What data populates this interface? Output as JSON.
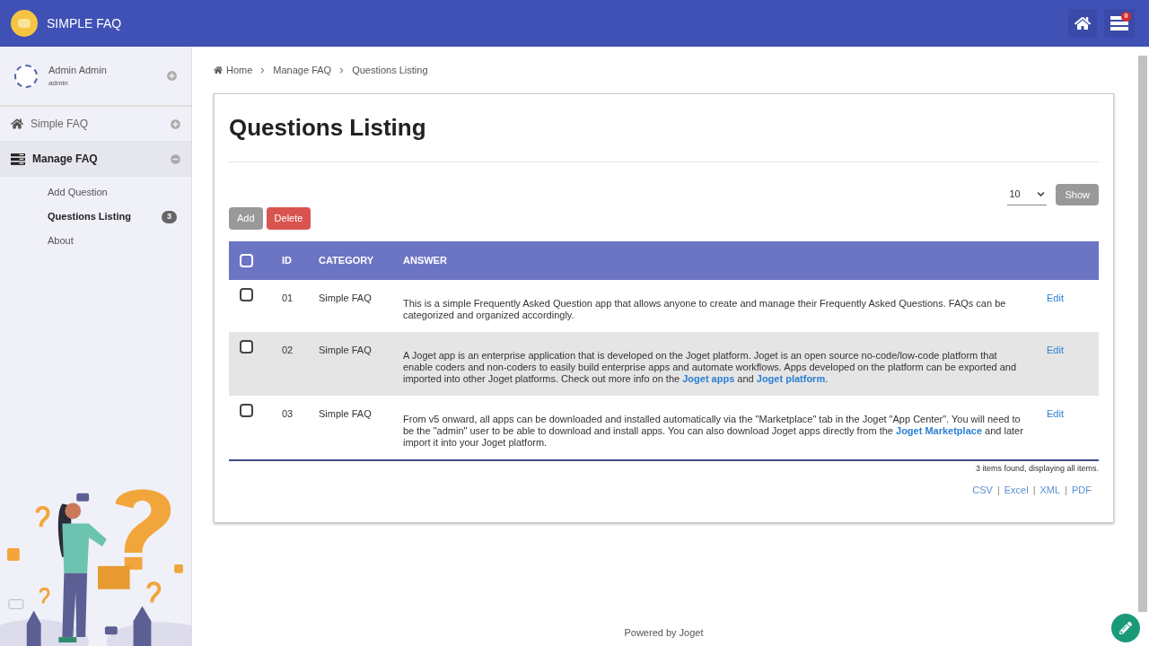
{
  "header": {
    "title": "SIMPLE FAQ",
    "notification_count": "0"
  },
  "sidebar": {
    "user": {
      "name": "Admin Admin",
      "username": "admin"
    },
    "menus": [
      {
        "label": "Simple FAQ",
        "expanded": false,
        "selected": false
      },
      {
        "label": "Manage FAQ",
        "expanded": true,
        "selected": true,
        "children": [
          {
            "label": "Add Question",
            "selected": false
          },
          {
            "label": "Questions Listing",
            "selected": true,
            "badge": "3"
          },
          {
            "label": "About",
            "selected": false
          }
        ]
      }
    ]
  },
  "breadcrumb": [
    "Home",
    "Manage FAQ",
    "Questions Listing"
  ],
  "page_title": "Questions Listing",
  "page_size": "10",
  "show_button": "Show",
  "actions": [
    {
      "label": "Add",
      "kind": "default"
    },
    {
      "label": "Delete",
      "kind": "danger"
    }
  ],
  "table": {
    "columns": [
      "ID",
      "CATEGORY",
      "ANSWER"
    ],
    "all_checked": false,
    "rows": [
      {
        "checked": false,
        "id": "01",
        "category": "Simple FAQ",
        "answer": [
          {
            "kind": "text",
            "text": "This is a simple Frequently Asked Question app that allows anyone to create and manage their Frequently Asked Questions. FAQs can be categorized and organized accordingly."
          }
        ],
        "action": "Edit"
      },
      {
        "checked": false,
        "id": "02",
        "category": "Simple FAQ",
        "answer": [
          {
            "kind": "text",
            "text": "A Joget app is an enterprise application that is developed on the Joget platform. Joget is an open source no-code/low-code platform that enable coders and non-coders to easily build enterprise apps and automate workflows. Apps developed on the platform can be exported and imported into other Joget platforms. Check out more info on the "
          },
          {
            "kind": "link",
            "text": "Joget apps"
          },
          {
            "kind": "text",
            "text": " and "
          },
          {
            "kind": "link",
            "text": "Joget platform"
          },
          {
            "kind": "text",
            "text": "."
          }
        ],
        "action": "Edit"
      },
      {
        "checked": false,
        "id": "03",
        "category": "Simple FAQ",
        "answer": [
          {
            "kind": "text",
            "text": "From v5 onward, all apps can be downloaded and installed automatically via the \"Marketplace\" tab in the Joget \"App Center\". You will need to be the \"admin\" user to be able to download and install apps. You can also download Joget apps directly from the "
          },
          {
            "kind": "link",
            "text": "Joget Marketplace"
          },
          {
            "kind": "text",
            "text": " and later import it into your Joget platform."
          }
        ],
        "action": "Edit"
      }
    ]
  },
  "summary": "3 items found, displaying all items.",
  "exports": [
    {
      "label": "CSV",
      "separator": "|"
    },
    {
      "label": "Excel",
      "separator": "|"
    },
    {
      "label": "XML",
      "separator": "|"
    },
    {
      "label": "PDF"
    }
  ],
  "footer": "Powered by Joget"
}
